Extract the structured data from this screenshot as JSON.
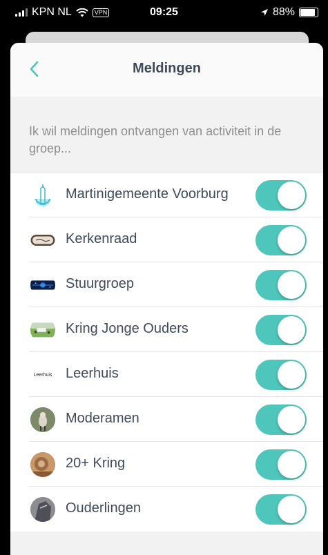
{
  "status_bar": {
    "carrier": "KPN NL",
    "vpn": "VPN",
    "time": "09:25",
    "battery": "88%",
    "battery_level": 0.88
  },
  "nav": {
    "title": "Meldingen",
    "back_icon": "chevron-left-icon"
  },
  "section": {
    "text": "Ik wil meldingen ontvangen van activiteit in de groep..."
  },
  "groups": [
    {
      "label": "Martinigemeente Voorburg",
      "enabled": true
    },
    {
      "label": "Kerkenraad",
      "enabled": true
    },
    {
      "label": "Stuurgroep",
      "enabled": true
    },
    {
      "label": "Kring Jonge Ouders",
      "enabled": true
    },
    {
      "label": "Leerhuis",
      "enabled": true,
      "avatar_text": "Leerhuis"
    },
    {
      "label": "Moderamen",
      "enabled": true
    },
    {
      "label": "20+ Kring",
      "enabled": true
    },
    {
      "label": "Ouderlingen",
      "enabled": true
    }
  ],
  "colors": {
    "accent": "#4fc6bb",
    "title": "#3e4a58",
    "section_text": "#8e8e8e"
  }
}
